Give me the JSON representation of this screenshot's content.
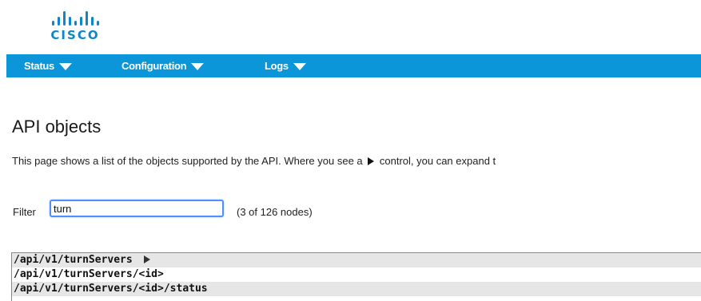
{
  "brand": {
    "logo_text": "CISCO"
  },
  "nav": {
    "items": [
      {
        "label": "Status",
        "icon": "caret-down-icon"
      },
      {
        "label": "Configuration",
        "icon": "caret-down-icon"
      },
      {
        "label": "Logs",
        "icon": "caret-down-icon"
      }
    ],
    "background_color": "#0a96d9"
  },
  "page": {
    "title": "API objects",
    "intro_before_icon": "This page shows a list of the objects supported by the API. Where you see a",
    "intro_after_icon": "control, you can expand t"
  },
  "filter": {
    "label": "Filter",
    "value": "turn",
    "count_text": "(3 of 126 nodes)"
  },
  "results": [
    {
      "path": "/api/v1/turnServers",
      "expandable": true
    },
    {
      "path": "/api/v1/turnServers/<id>",
      "expandable": false
    },
    {
      "path": "/api/v1/turnServers/<id>/status",
      "expandable": false
    }
  ]
}
